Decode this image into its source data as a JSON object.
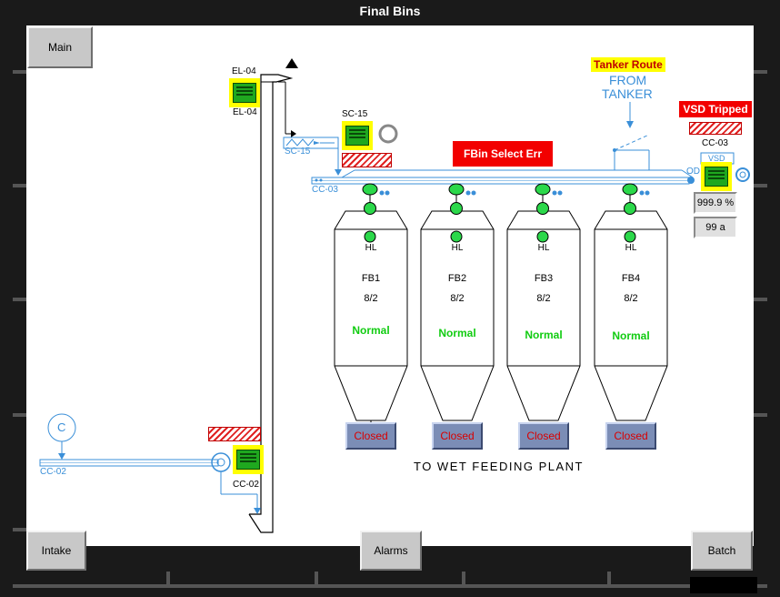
{
  "window": {
    "title": "Final Bins"
  },
  "nav": {
    "main": "Main",
    "intake": "Intake",
    "alarms": "Alarms",
    "batch": "Batch"
  },
  "equipment": {
    "el04_top": "EL-04",
    "el04_bottom": "EL-04",
    "sc15_top": "SC-15",
    "sc15_conveyor": "SC-15",
    "cc03_conveyor": "CC-03",
    "cc03_motor": "CC-03",
    "cc02_conveyor": "CC-02",
    "cc02_motor": "CC-02",
    "c_symbol": "C",
    "od_label": "OD",
    "vsd_label": "VSD"
  },
  "alerts": {
    "fbin_select": "FBin Select Err",
    "vsd_tripped": "VSD Tripped"
  },
  "tanker": {
    "route_label": "Tanker Route",
    "from_line1": "FROM",
    "from_line2": "TANKER"
  },
  "readouts": {
    "speed": "999.9 %",
    "current": "99 a"
  },
  "bins": [
    {
      "id": "FB1",
      "level": "8/2",
      "hl": "HL",
      "status": "Normal",
      "valve": "Closed"
    },
    {
      "id": "FB2",
      "level": "8/2",
      "hl": "HL",
      "status": "Normal",
      "valve": "Closed"
    },
    {
      "id": "FB3",
      "level": "8/2",
      "hl": "HL",
      "status": "Normal",
      "valve": "Closed"
    },
    {
      "id": "FB4",
      "level": "8/2",
      "hl": "HL",
      "status": "Normal",
      "valve": "Closed"
    }
  ],
  "destination": "TO WET FEEDING PLANT",
  "colors": {
    "running_motor": "#1fa81f",
    "alarm": "#f20000",
    "status_ok": "#11cc11",
    "process_line": "#3a8fd8"
  }
}
